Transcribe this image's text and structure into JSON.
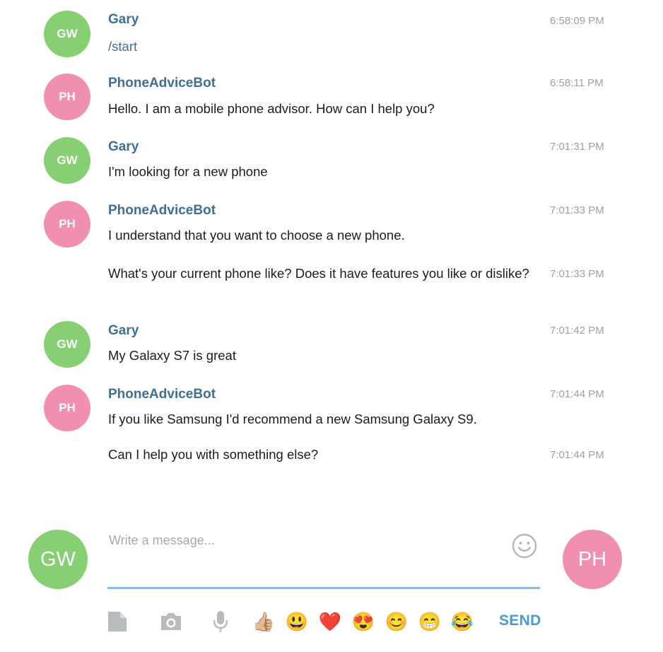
{
  "messages": [
    {
      "initials": "GW",
      "name": "Gary",
      "text": "/start",
      "time": "6:58:09 PM"
    },
    {
      "initials": "PH",
      "name": "PhoneAdviceBot",
      "text": "Hello. I am a mobile phone advisor. How can I help you?",
      "time": "6:58:11 PM"
    },
    {
      "initials": "GW",
      "name": "Gary",
      "text": "I'm looking for a new phone",
      "time": "7:01:31 PM"
    },
    {
      "initials": "PH",
      "name": "PhoneAdviceBot",
      "text": "I understand that you want to choose a new phone.",
      "time": "7:01:33 PM"
    },
    {
      "text": "What's your current phone like? Does it have features you like or dislike?",
      "time": "7:01:33 PM"
    },
    {
      "initials": "GW",
      "name": "Gary",
      "text": "My Galaxy S7 is great",
      "time": "7:01:42 PM"
    },
    {
      "initials": "PH",
      "name": "PhoneAdviceBot",
      "text": "If you like Samsung I'd recommend a new Samsung Galaxy S9.",
      "time": "7:01:44 PM"
    },
    {
      "text": "Can I help you with something else?",
      "time": "7:01:44 PM"
    }
  ],
  "composer": {
    "user_initials": "GW",
    "bot_initials": "PH",
    "placeholder": "Write a message...",
    "send_label": "SEND",
    "emojis": [
      "👍🏼",
      "😃",
      "❤️",
      "😍",
      "😊",
      "😁",
      "😂"
    ]
  },
  "colors": {
    "user_avatar": "#86cf72",
    "bot_avatar": "#f18fb0",
    "name": "#3f6f96",
    "accent": "#4a9ad6",
    "timestamp": "#9aa0a6"
  },
  "icons": [
    "file-icon",
    "camera-icon",
    "microphone-icon",
    "smile-icon"
  ]
}
